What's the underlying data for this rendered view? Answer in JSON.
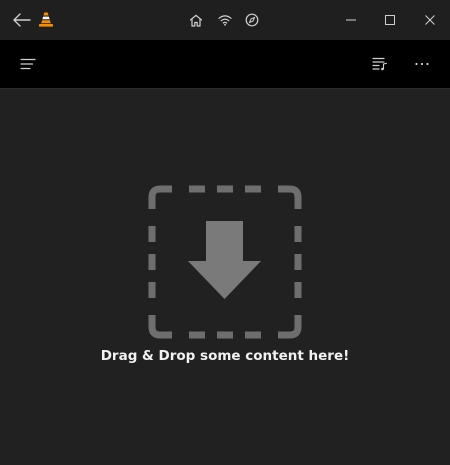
{
  "titlebar": {
    "back_icon": "back-arrow-icon",
    "app_icon": "vlc-cone-icon",
    "center_icons": [
      "home-icon",
      "network-icon",
      "browse-icon"
    ],
    "window_controls": [
      "minimize-icon",
      "maximize-icon",
      "close-icon"
    ]
  },
  "header": {
    "menu_icon": "hamburger-menu-icon",
    "playlist_icon": "playlist-icon",
    "more_icon": "more-options-icon"
  },
  "main": {
    "drop_icon": "drop-zone-icon",
    "drop_text": "Drag & Drop some content here!"
  },
  "colors": {
    "background": "#212121",
    "header": "#000000",
    "icon_gray": "#6e6e6e",
    "vlc_orange": "#f28c00"
  }
}
